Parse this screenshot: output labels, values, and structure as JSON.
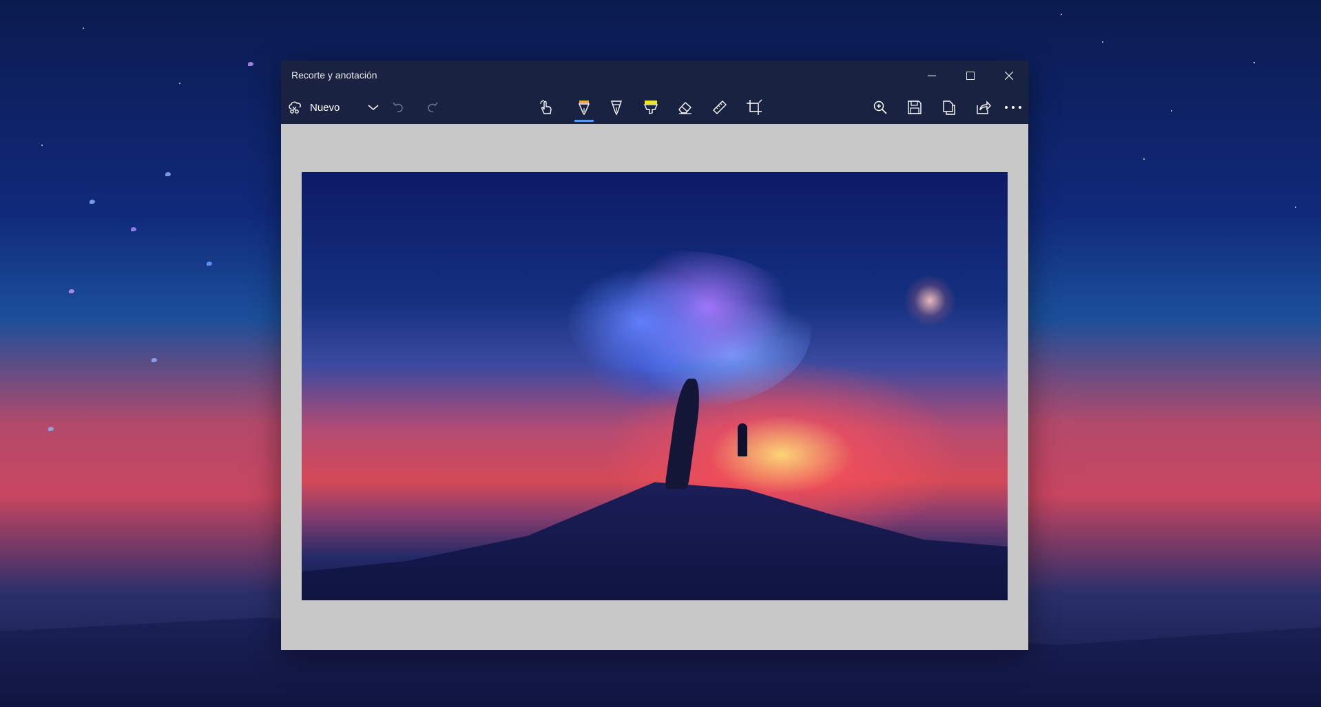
{
  "app": {
    "title": "Recorte y anotación"
  },
  "toolbar": {
    "new_label": "Nuevo",
    "left_icons": [
      "snip-icon",
      "chevron-down-icon",
      "undo-icon",
      "redo-icon"
    ],
    "center_tools": [
      "touch-writing-icon",
      "ballpoint-pen-icon",
      "pencil-icon",
      "highlighter-icon",
      "eraser-icon",
      "ruler-icon",
      "crop-icon"
    ],
    "active_tool": "ballpoint-pen-icon",
    "right_icons": [
      "zoom-in-icon",
      "save-icon",
      "copy-icon",
      "share-icon",
      "more-icon"
    ]
  },
  "window_controls": [
    "minimize-icon",
    "maximize-icon",
    "close-icon"
  ],
  "colors": {
    "titlebar": "#1a2241",
    "canvas": "#c8c8c8",
    "pen_tip": "#f2b13c",
    "highlighter": "#f5e33b",
    "accent": "#4aa0ff"
  }
}
